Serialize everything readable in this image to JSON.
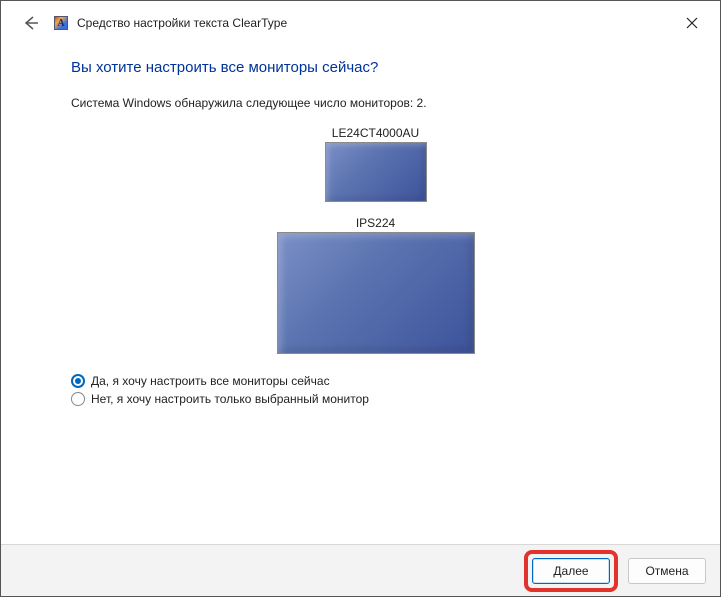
{
  "window": {
    "title": "Средство настройки текста ClearType"
  },
  "page": {
    "heading": "Вы хотите настроить все мониторы сейчас?",
    "subtext": "Система Windows обнаружила следующее число мониторов: 2."
  },
  "monitors": [
    {
      "name": "LE24CT4000AU"
    },
    {
      "name": "IPS224"
    }
  ],
  "radios": {
    "option1": "Да, я хочу настроить все мониторы сейчас",
    "option2": "Нет, я хочу настроить только выбранный монитор",
    "selected": 0
  },
  "footer": {
    "next": "Далее",
    "cancel": "Отмена"
  }
}
